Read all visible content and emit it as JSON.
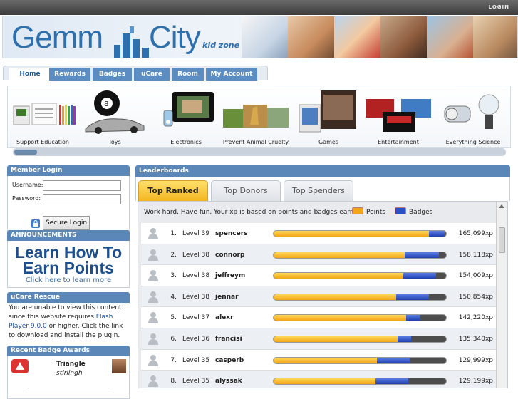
{
  "topbar": {
    "login": "LOGIN"
  },
  "logo": {
    "gemm": "Gemm",
    "city": "City",
    "kidzone": "kid zone"
  },
  "nav": {
    "tabs": [
      "Home",
      "Rewards",
      "Badges",
      "uCare",
      "Room",
      "My Account"
    ],
    "active": "Home"
  },
  "categories": [
    "Support Education",
    "Toys",
    "Electronics",
    "Prevent Animal Cruelty",
    "Games",
    "Entertainment",
    "Everything Science"
  ],
  "login": {
    "title": "Member Login",
    "username_label": "Username:",
    "password_label": "Password:",
    "button": "Secure Login",
    "username_value": "",
    "password_value": ""
  },
  "announcements": {
    "title": "ANNOUNCEMENTS",
    "line1": "Learn How To",
    "line2": "Earn Points",
    "line3": "Click here to learn more"
  },
  "ucare": {
    "title": "uCare Rescue",
    "text_before": "You are unable to view this content since this website requires ",
    "link": "Flash Player 9.0.0",
    "text_after": " or higher. Click the link to download and install the plugin."
  },
  "badges": {
    "title": "Recent Badge Awards",
    "badge_name": "Triangle",
    "user": "stirlingh"
  },
  "leaderboards": {
    "title": "Leaderboards",
    "tabs": [
      "Top Ranked",
      "Top Donors",
      "Top Spenders"
    ],
    "active_tab": "Top Ranked",
    "intro": "Work hard. Have fun. Your xp is based on points and badges earned.",
    "legend_points": "Points",
    "legend_badges": "Badges",
    "colors": {
      "points": "#f2a516",
      "badges": "#2a4fc4",
      "rest": "#4d4d4d"
    },
    "rows": [
      {
        "rank": "1.",
        "level": "Level 39",
        "name": "spencers",
        "xp": "165,099xp",
        "points_frac": 0.9,
        "badges_frac": 0.09
      },
      {
        "rank": "2.",
        "level": "Level 38",
        "name": "connorp",
        "xp": "158,118xp",
        "points_frac": 0.76,
        "badges_frac": 0.2
      },
      {
        "rank": "3.",
        "level": "Level 38",
        "name": "jeffreym",
        "xp": "154,009xp",
        "points_frac": 0.75,
        "badges_frac": 0.19
      },
      {
        "rank": "4.",
        "level": "Level 38",
        "name": "jennar",
        "xp": "150,854xp",
        "points_frac": 0.71,
        "badges_frac": 0.19
      },
      {
        "rank": "5.",
        "level": "Level 37",
        "name": "alexr",
        "xp": "142,220xp",
        "points_frac": 0.77,
        "badges_frac": 0.08
      },
      {
        "rank": "6.",
        "level": "Level 36",
        "name": "francisi",
        "xp": "135,340xp",
        "points_frac": 0.72,
        "badges_frac": 0.08
      },
      {
        "rank": "7.",
        "level": "Level 35",
        "name": "casperb",
        "xp": "129,999xp",
        "points_frac": 0.6,
        "badges_frac": 0.19
      },
      {
        "rank": "8.",
        "level": "Level 35",
        "name": "alyssak",
        "xp": "129,199xp",
        "points_frac": 0.59,
        "badges_frac": 0.19
      }
    ]
  }
}
